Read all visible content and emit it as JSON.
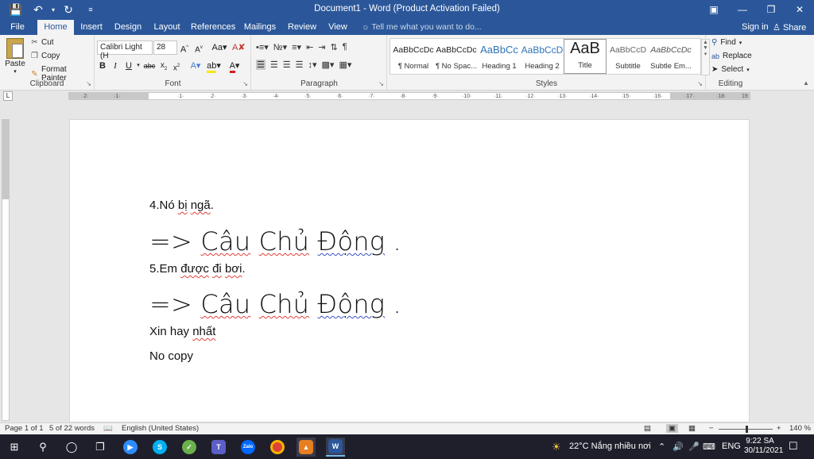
{
  "window": {
    "title": "Document1 - Word (Product Activation Failed)"
  },
  "quick_access": {
    "save_icon": "save-icon",
    "undo_icon": "undo-icon",
    "redo_icon": "redo-icon"
  },
  "tabs": [
    {
      "label": "File"
    },
    {
      "label": "Home"
    },
    {
      "label": "Insert"
    },
    {
      "label": "Design"
    },
    {
      "label": "Layout"
    },
    {
      "label": "References"
    },
    {
      "label": "Mailings"
    },
    {
      "label": "Review"
    },
    {
      "label": "View"
    }
  ],
  "tell_me": "Tell me what you want to do...",
  "account": {
    "sign_in": "Sign in",
    "share": "Share"
  },
  "clipboard": {
    "paste": "Paste",
    "cut": "Cut",
    "copy": "Copy",
    "format_painter": "Format Painter",
    "label": "Clipboard"
  },
  "font": {
    "name": "Calibri Light (H",
    "size": "28",
    "label": "Font"
  },
  "paragraph": {
    "label": "Paragraph"
  },
  "styles": {
    "label": "Styles",
    "items": [
      {
        "preview": "AaBbCcDc",
        "name": "¶ Normal"
      },
      {
        "preview": "AaBbCcDc",
        "name": "¶ No Spac..."
      },
      {
        "preview": "AaBbCc",
        "name": "Heading 1"
      },
      {
        "preview": "AaBbCcD",
        "name": "Heading 2"
      },
      {
        "preview": "AaB",
        "name": "Title"
      },
      {
        "preview": "AaBbCcD",
        "name": "Subtitle"
      },
      {
        "preview": "AaBbCcDc",
        "name": "Subtle Em..."
      }
    ]
  },
  "editing": {
    "find": "Find",
    "replace": "Replace",
    "select": "Select",
    "label": "Editing"
  },
  "document": {
    "lines": [
      {
        "prefix": "4.Nó ",
        "w1": "bị",
        "mid": " ",
        "w2": "ngã",
        "suffix": "."
      },
      {
        "arrow": "=> ",
        "w1": "Câu",
        "sp1": " ",
        "w2": "Chủ",
        "sp2": " ",
        "w3": "Động",
        "suffix": " ."
      },
      {
        "prefix": "5.Em ",
        "w1": "được",
        "mid": " ",
        "w2": "đi",
        "sp": " ",
        "w3": "bơi",
        "suffix": "."
      },
      {
        "arrow": "=> ",
        "w1": "Câu",
        "sp1": " ",
        "w2": "Chủ",
        "sp2": " ",
        "w3": "Động",
        "suffix": " ."
      },
      {
        "prefix": "Xin hay ",
        "w1": "nhất"
      },
      {
        "text": "No copy"
      }
    ]
  },
  "statusbar": {
    "page": "Page 1 of 1",
    "words": "5 of 22 words",
    "language": "English (United States)",
    "zoom": "140 %"
  },
  "taskbar": {
    "weather": "22°C  Nắng nhiều nơi",
    "lang": "ENG",
    "time": "9:22 SA",
    "date": "30/11/2021"
  }
}
